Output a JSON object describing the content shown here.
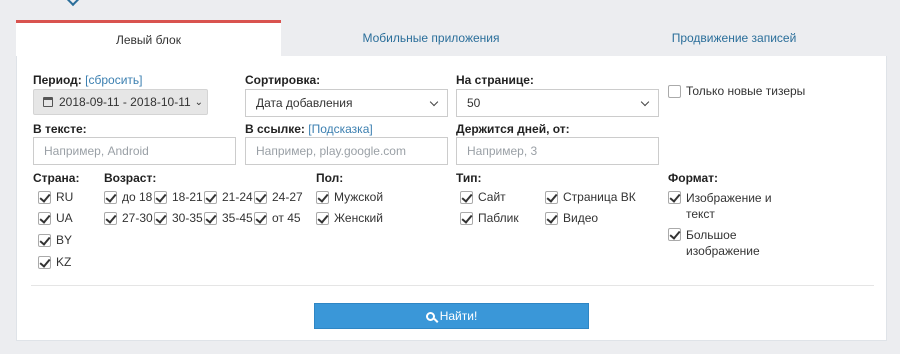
{
  "tabs": [
    {
      "label": "Левый блок"
    },
    {
      "label": "Мобильные приложения"
    },
    {
      "label": "Продвижение записей"
    }
  ],
  "filters": {
    "period": {
      "label": "Период:",
      "reset_label": "[сбросить]",
      "value": "2018-09-11 - 2018-10-11"
    },
    "sort": {
      "label": "Сортировка:",
      "value": "Дата добавления"
    },
    "per_page": {
      "label": "На странице:",
      "value": "50"
    },
    "new_only": {
      "label": "Только новые тизеры",
      "checked": false
    },
    "text": {
      "label": "В тексте:",
      "placeholder": "Например, Android"
    },
    "link": {
      "label": "В ссылке:",
      "hint_label": "[Подсказка]",
      "placeholder": "Например, play.google.com"
    },
    "days": {
      "label": "Держится дней, от:",
      "placeholder": "Например, 3"
    },
    "country": {
      "label": "Страна:",
      "items": [
        "RU",
        "UA",
        "BY",
        "KZ"
      ]
    },
    "age": {
      "label": "Возраст:",
      "items": [
        "до 18",
        "18-21",
        "21-24",
        "24-27",
        "27-30",
        "30-35",
        "35-45",
        "от 45"
      ]
    },
    "gender": {
      "label": "Пол:",
      "items": [
        "Мужской",
        "Женский"
      ]
    },
    "type": {
      "label": "Тип:",
      "items": [
        "Сайт",
        "Страница ВК",
        "Паблик",
        "Видео"
      ]
    },
    "format": {
      "label": "Формат:",
      "items": [
        "Изображение и текст",
        "Большое изображение"
      ]
    }
  },
  "find_button": {
    "label": "Найти!"
  }
}
